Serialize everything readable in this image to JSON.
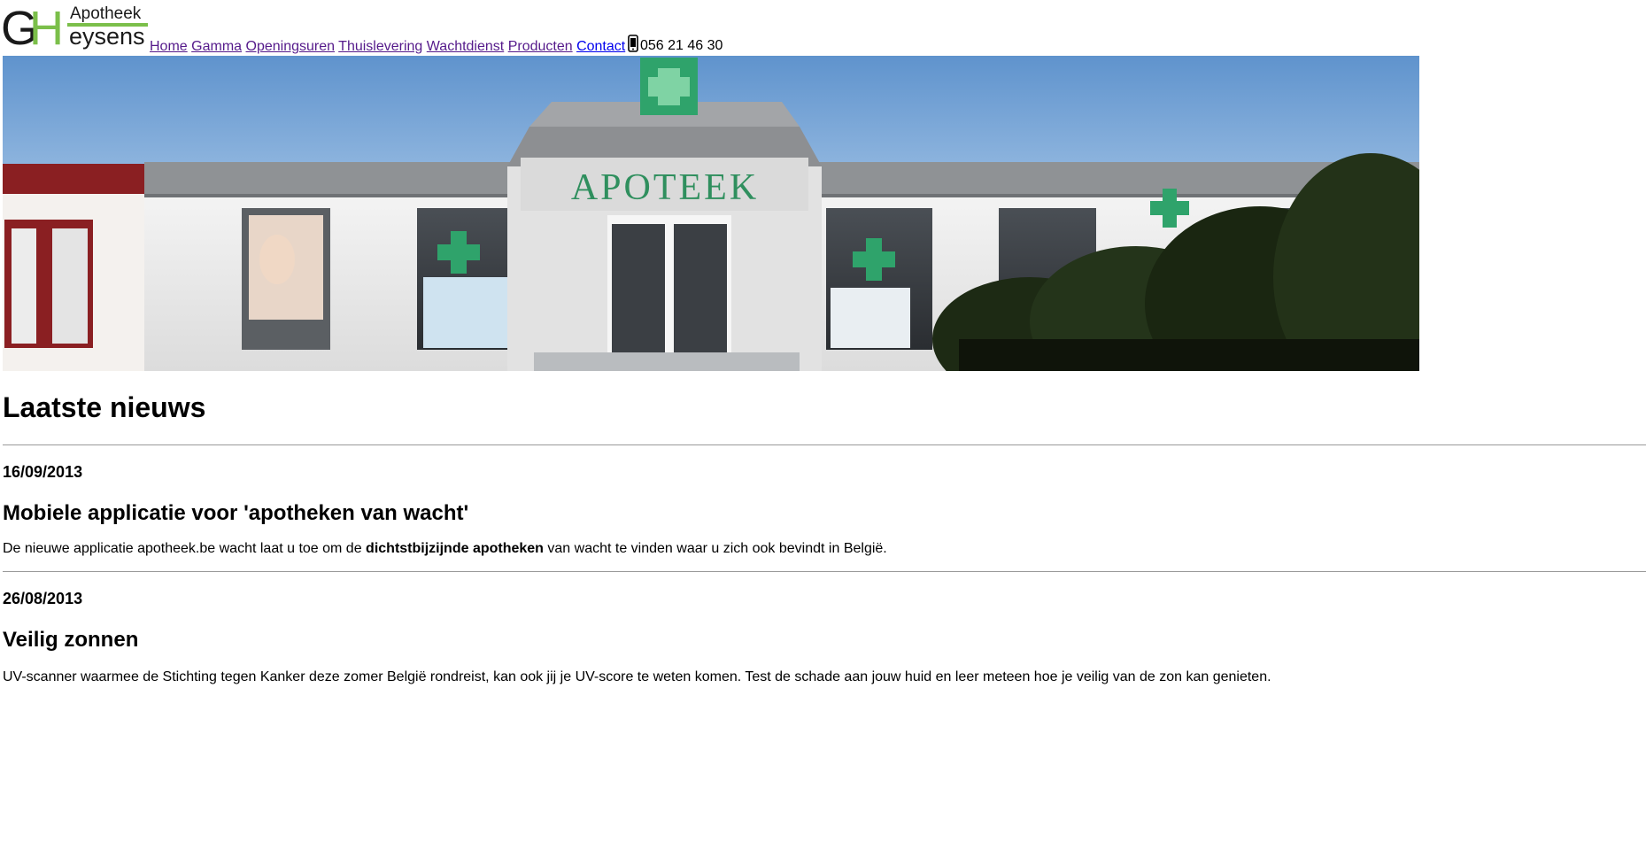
{
  "logo": {
    "initials_g": "G",
    "initials_h": "H",
    "top_word": "Apotheek",
    "bottom_word": "eysens",
    "accent_color": "#7bbf4a"
  },
  "nav": {
    "items": [
      {
        "label": "Home"
      },
      {
        "label": "Gamma"
      },
      {
        "label": "Openingsuren"
      },
      {
        "label": "Thuislevering"
      },
      {
        "label": "Wachtdienst"
      },
      {
        "label": "Producten"
      },
      {
        "label": "Contact"
      }
    ],
    "link_color": "#551a8b",
    "active_link_color": "#0000ee"
  },
  "phone": {
    "icon": "mobile-phone-icon",
    "number": "056 21 46 30"
  },
  "banner": {
    "sign_text": "APOTEEK",
    "cross_color": "#2fa36b",
    "sky_color": "#6e9cd0"
  },
  "news": {
    "title": "Laatste nieuws",
    "articles": [
      {
        "date": "16/09/2013",
        "title": "Mobiele applicatie voor 'apotheken van wacht'",
        "body_before": "De nieuwe applicatie apotheek.be wacht laat u toe om de ",
        "body_bold": "dichtstbijzijnde apotheken",
        "body_after": " van wacht te vinden waar u zich ook bevindt in België."
      },
      {
        "date": "26/08/2013",
        "title": "Veilig zonnen",
        "body": "UV-scanner waarmee de Stichting tegen Kanker deze zomer België rondreist, kan ook jij je UV-score te weten komen. Test de schade aan jouw huid en leer meteen hoe je veilig van de zon kan genieten."
      }
    ]
  }
}
